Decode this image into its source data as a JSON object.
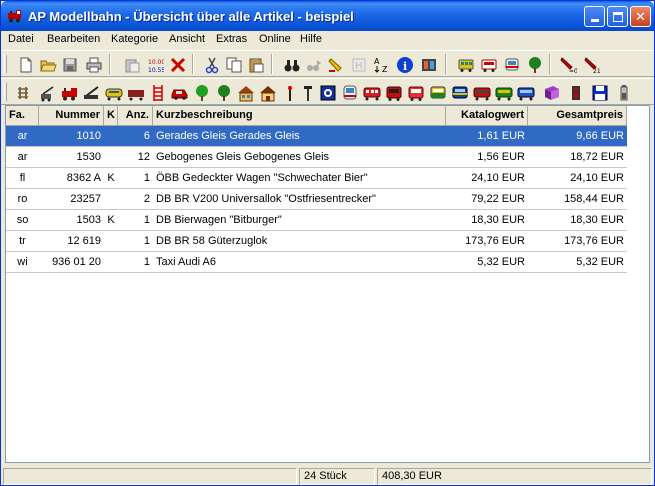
{
  "window": {
    "title": "AP Modellbahn - Übersicht über alle Artikel - beispiel"
  },
  "menu": [
    "Datei",
    "Bearbeiten",
    "Kategorie",
    "Ansicht",
    "Extras",
    "Online",
    "Hilfe"
  ],
  "toolbar1_icons": [
    "new-file-icon",
    "open-folder-icon",
    "save-icon",
    "print-icon",
    "paste-icon",
    "numbering-icon",
    "delete-icon",
    "cut-icon",
    "copy-icon",
    "paste-icon",
    "binoculars-icon",
    "find-next-icon",
    "highlight-icon",
    "hide-icon",
    "sort-az-icon",
    "info-icon",
    "film-icon",
    "tram-icon",
    "bus-icon",
    "train-front-icon",
    "tree-icon",
    "reset-filter-icon",
    "sort-filter-icon"
  ],
  "toolbar2_icons": [
    "track-icon",
    "crane-icon",
    "locomotive-red-icon",
    "crane-wagon-icon",
    "tank-wagon-icon",
    "freight-wagon-icon",
    "ladder-icon",
    "car-icon",
    "tree-icon",
    "house-icon",
    "signal-icon",
    "lamp-icon",
    "control-panel-icon",
    "train-front-icon",
    "passenger-wagon-icon",
    "tram-red-icon",
    "passenger-red-icon",
    "passenger-green-icon",
    "passenger-blue-icon",
    "railcar-icon",
    "book-icon",
    "speaker-icon",
    "disk-icon",
    "battery-icon"
  ],
  "table": {
    "columns": [
      "Fa.",
      "Nummer",
      "K",
      "Anz.",
      "Kurzbeschreibung",
      "Katalogwert",
      "Gesamtpreis"
    ],
    "rows": [
      {
        "fa": "ar",
        "nummer": "1010",
        "k": "",
        "anz": "6",
        "beschreibung": "Gerades Gleis Gerades Gleis",
        "katalogwert": "1,61 EUR",
        "gesamtpreis": "9,66 EUR",
        "selected": true
      },
      {
        "fa": "ar",
        "nummer": "1530",
        "k": "",
        "anz": "12",
        "beschreibung": "Gebogenes Gleis Gebogenes Gleis",
        "katalogwert": "1,56 EUR",
        "gesamtpreis": "18,72 EUR",
        "selected": false
      },
      {
        "fa": "fl",
        "nummer": "8362 A",
        "k": "K",
        "anz": "1",
        "beschreibung": "ÖBB Gedeckter Wagen \"Schwechater Bier\"",
        "katalogwert": "24,10 EUR",
        "gesamtpreis": "24,10 EUR",
        "selected": false
      },
      {
        "fa": "ro",
        "nummer": "23257",
        "k": "",
        "anz": "2",
        "beschreibung": "DB BR V200 Universallok \"Ostfriesentrecker\"",
        "katalogwert": "79,22 EUR",
        "gesamtpreis": "158,44 EUR",
        "selected": false
      },
      {
        "fa": "so",
        "nummer": "1503",
        "k": "K",
        "anz": "1",
        "beschreibung": "DB Bierwagen \"Bitburger\"",
        "katalogwert": "18,30 EUR",
        "gesamtpreis": "18,30 EUR",
        "selected": false
      },
      {
        "fa": "tr",
        "nummer": "12 619",
        "k": "",
        "anz": "1",
        "beschreibung": "DB BR 58 Güterzuglok",
        "katalogwert": "173,76 EUR",
        "gesamtpreis": "173,76 EUR",
        "selected": false
      },
      {
        "fa": "wi",
        "nummer": "936 01 20",
        "k": "",
        "anz": "1",
        "beschreibung": "Taxi Audi A6",
        "katalogwert": "5,32 EUR",
        "gesamtpreis": "5,32 EUR",
        "selected": false
      }
    ]
  },
  "status": {
    "count": "24 Stück",
    "total": "408,30 EUR"
  },
  "colors": {
    "selection": "#316ac5",
    "titlebar": "#0a55d8",
    "face": "#ece9d8"
  }
}
